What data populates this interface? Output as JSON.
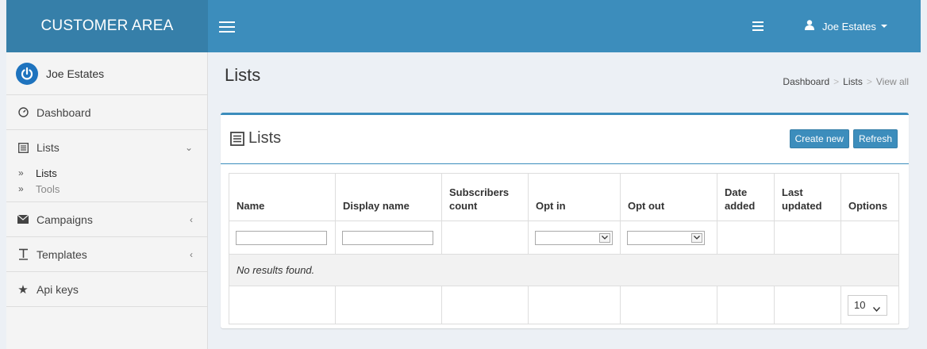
{
  "app": {
    "brand": "CUSTOMER AREA"
  },
  "topnav": {
    "user_name": "Joe Estates"
  },
  "sidebar": {
    "user_name": "Joe Estates",
    "items": [
      {
        "label": "Dashboard",
        "icon": "dashboard-icon"
      },
      {
        "label": "Lists",
        "icon": "list-icon",
        "expanded": true,
        "children": [
          {
            "label": "Lists",
            "active": true
          },
          {
            "label": "Tools"
          }
        ]
      },
      {
        "label": "Campaigns",
        "icon": "envelope-icon"
      },
      {
        "label": "Templates",
        "icon": "text-icon"
      },
      {
        "label": "Api keys",
        "icon": "star-icon"
      }
    ]
  },
  "page": {
    "title": "Lists",
    "breadcrumb": [
      "Dashboard",
      "Lists",
      "View all"
    ]
  },
  "box": {
    "title": "Lists",
    "create_label": "Create new",
    "refresh_label": "Refresh"
  },
  "table": {
    "columns": [
      "Name",
      "Display name",
      "Subscribers count",
      "Opt in",
      "Opt out",
      "Date added",
      "Last updated",
      "Options"
    ],
    "filters": {
      "name": "",
      "display_name": "",
      "opt_in": "",
      "opt_out": ""
    },
    "empty_message": "No results found.",
    "page_size": "10"
  },
  "colors": {
    "header": "#3c8dbc",
    "header_dark": "#367fa9",
    "sidebar_bg": "#f4f4f4",
    "content_bg": "#ecf0f5"
  }
}
